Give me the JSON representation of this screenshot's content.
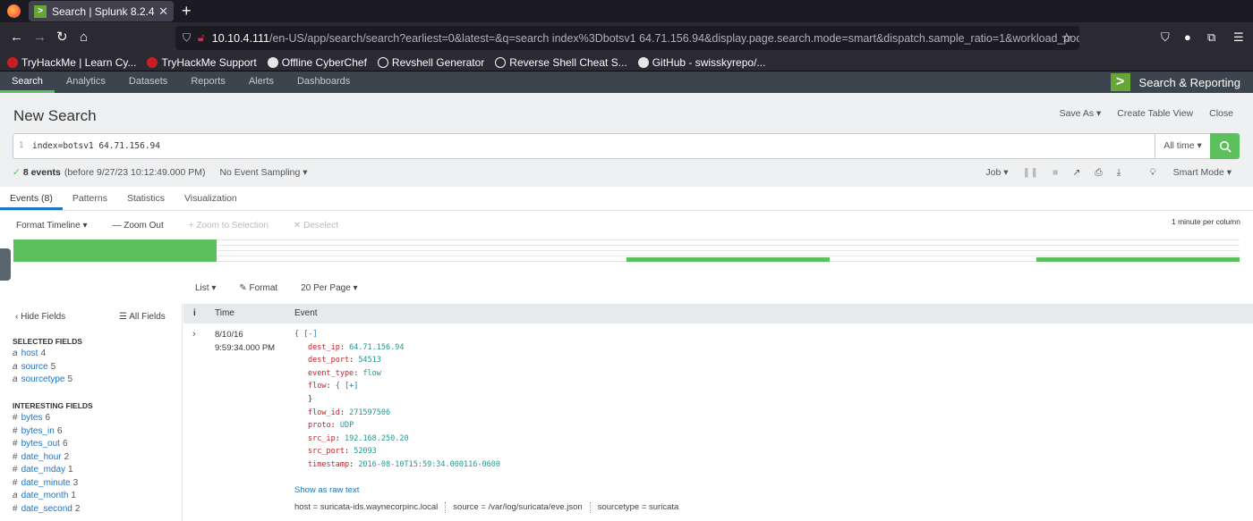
{
  "browser": {
    "tab_title": "Search | Splunk 8.2.4",
    "tab_favicon": ">",
    "url_host": "10.10.4.111",
    "url_rest": "/en-US/app/search/search?earliest=0&latest=&q=search index%3Dbotsv1 64.71.156.94&display.page.search.mode=smart&dispatch.sample_ratio=1&workload_pool=&display",
    "bookmarks": [
      "TryHackMe | Learn Cy...",
      "TryHackMe Support",
      "Offline CyberChef",
      "Revshell Generator",
      "Reverse Shell Cheat S...",
      "GitHub - swisskyrepo/..."
    ]
  },
  "appbar": {
    "nav": [
      "Search",
      "Analytics",
      "Datasets",
      "Reports",
      "Alerts",
      "Dashboards"
    ],
    "brand": "Search & Reporting",
    "brand_logo": ">"
  },
  "header": {
    "title": "New Search",
    "actions": [
      "Save As ▾",
      "Create Table View",
      "Close"
    ]
  },
  "search": {
    "line_no": "1",
    "query": "index=botsv1 64.71.156.94",
    "time_range": "All time ▾"
  },
  "status": {
    "events_count": "8 events",
    "before": "(before 9/27/23 10:12:49.000 PM)",
    "sampling": "No Event Sampling ▾",
    "job": "Job ▾",
    "mode": "Smart Mode ▾"
  },
  "tabs": [
    "Events (8)",
    "Patterns",
    "Statistics",
    "Visualization"
  ],
  "timeline": {
    "format": "Format Timeline ▾",
    "zoom_out": "— Zoom Out",
    "zoom_sel": "+ Zoom to Selection",
    "deselect": "✕ Deselect",
    "scale": "1 minute per column",
    "bars": [
      {
        "start": 0.0,
        "end": 0.166,
        "level": 1.0
      },
      {
        "start": 0.5,
        "end": 0.666,
        "level": 0.2
      },
      {
        "start": 0.834,
        "end": 1.0,
        "level": 0.2
      }
    ]
  },
  "list_tools": [
    "List ▾",
    "✎ Format",
    "20 Per Page ▾"
  ],
  "fields": {
    "hide": "‹ Hide Fields",
    "all": "☰ All Fields",
    "selected_title": "SELECTED FIELDS",
    "selected": [
      {
        "type": "a",
        "name": "host",
        "count": "4"
      },
      {
        "type": "a",
        "name": "source",
        "count": "5"
      },
      {
        "type": "a",
        "name": "sourcetype",
        "count": "5"
      }
    ],
    "interesting_title": "INTERESTING FIELDS",
    "interesting": [
      {
        "type": "#",
        "name": "bytes",
        "count": "6"
      },
      {
        "type": "#",
        "name": "bytes_in",
        "count": "6"
      },
      {
        "type": "#",
        "name": "bytes_out",
        "count": "6"
      },
      {
        "type": "#",
        "name": "date_hour",
        "count": "2"
      },
      {
        "type": "#",
        "name": "date_mday",
        "count": "1"
      },
      {
        "type": "#",
        "name": "date_minute",
        "count": "3"
      },
      {
        "type": "a",
        "name": "date_month",
        "count": "1"
      },
      {
        "type": "#",
        "name": "date_second",
        "count": "2"
      }
    ]
  },
  "events": {
    "col_info": "i",
    "col_time": "Time",
    "col_event": "Event",
    "expand": "›",
    "time_date": "8/10/16",
    "time_clock": "9:59:34.000 PM",
    "json_open": "{ [-]",
    "json_lines": [
      {
        "key": "dest_ip",
        "value": "64.71.156.94"
      },
      {
        "key": "dest_port",
        "value": "54513"
      },
      {
        "key": "event_type",
        "value": "flow"
      },
      {
        "key": "flow",
        "value": "{ [+]"
      },
      {
        "key": "",
        "value": "}"
      },
      {
        "key": "flow_id",
        "value": "271597506"
      },
      {
        "key": "proto",
        "value": "UDP"
      },
      {
        "key": "src_ip",
        "value": "192.168.250.20"
      },
      {
        "key": "src_port",
        "value": "52093"
      },
      {
        "key": "timestamp",
        "value": "2016-08-10T15:59:34.000116-0600"
      }
    ],
    "raw_link": "Show as raw text",
    "meta": {
      "host_label": "host = ",
      "host": "suricata-ids.waynecorpinc.local",
      "source_label": "source = ",
      "source": "/var/log/suricata/eve.json",
      "sourcetype_label": "sourcetype = ",
      "sourcetype": "suricata"
    }
  }
}
